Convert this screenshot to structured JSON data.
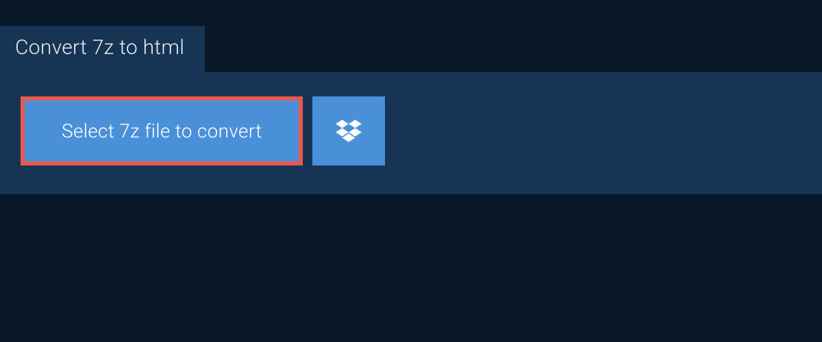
{
  "tab": {
    "label": "Convert 7z to html"
  },
  "actions": {
    "select_file_label": "Select 7z file to convert",
    "dropbox_icon_name": "dropbox"
  },
  "colors": {
    "background": "#0a1929",
    "panel": "#163453",
    "button": "#4a90d9",
    "highlight_border": "#e85a4f",
    "text_light": "#ffffff",
    "text_tab": "#e8eef4"
  }
}
